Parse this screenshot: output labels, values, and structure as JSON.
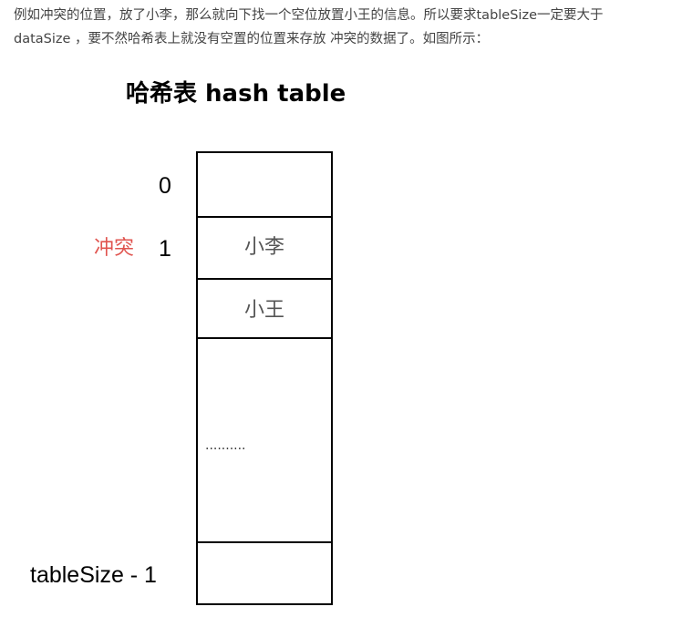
{
  "intro": {
    "line1": "例如冲突的位置，放了小李，那么就向下找一个空位放置小王的信息。所以要求tableSize一定要大于",
    "line2": "dataSize ，要不然哈希表上就没有空置的位置来存放 冲突的数据了。如图所示："
  },
  "diagram": {
    "title": "哈希表 hash table",
    "index_labels": {
      "first": "0",
      "second": "1",
      "last": "tableSize - 1"
    },
    "conflict_label": "冲突",
    "cells": {
      "cell_1": "小李",
      "cell_2": "小王",
      "ellipsis": ".........."
    }
  }
}
